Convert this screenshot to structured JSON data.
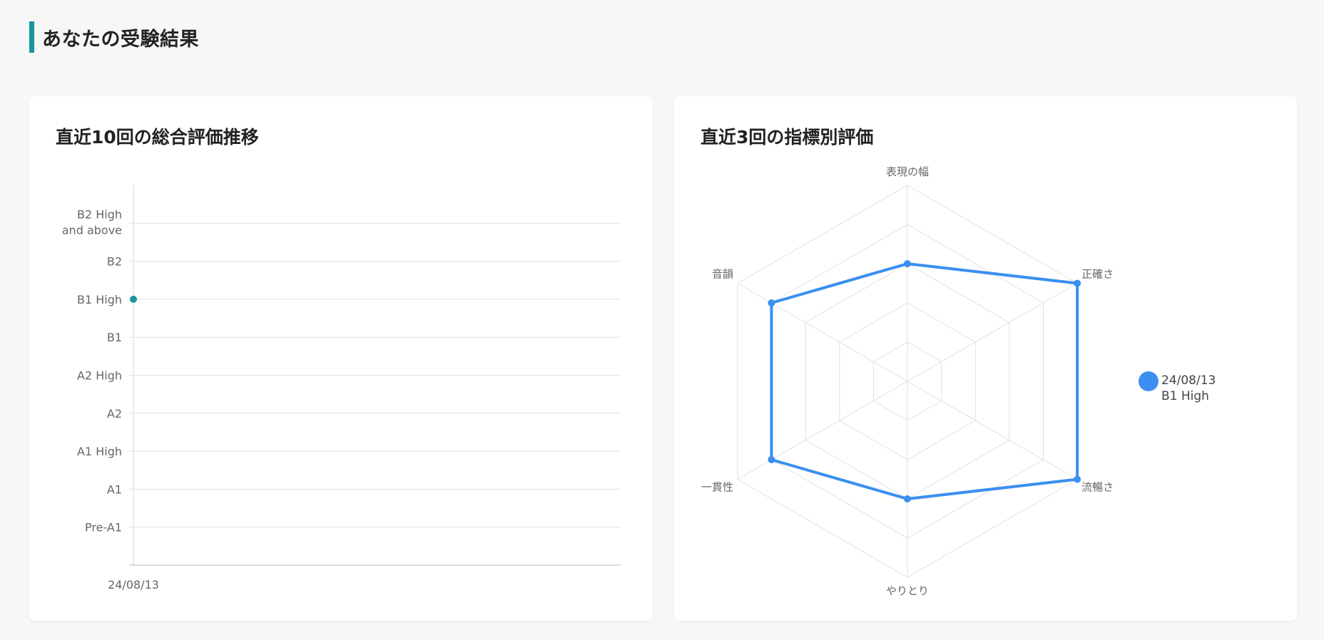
{
  "page": {
    "title": "あなたの受験結果"
  },
  "colors": {
    "accent": "#17949c",
    "series": "#3b8ff0",
    "grid": "#e0e0e0",
    "label": "#666666"
  },
  "cards": {
    "trend": {
      "title": "直近10回の総合評価推移"
    },
    "radar": {
      "title": "直近3回の指標別評価"
    }
  },
  "chart_data": [
    {
      "type": "scatter",
      "title": "直近10回の総合評価推移",
      "x": [
        "24/08/13"
      ],
      "y_levels": [
        {
          "value": 0,
          "label": "Pre-A1"
        },
        {
          "value": 1,
          "label": "A1"
        },
        {
          "value": 2,
          "label": "A1 High"
        },
        {
          "value": 3,
          "label": "A2"
        },
        {
          "value": 4,
          "label": "A2 High"
        },
        {
          "value": 5,
          "label": "B1"
        },
        {
          "value": 6,
          "label": "B1 High"
        },
        {
          "value": 7,
          "label": "B2"
        },
        {
          "value": 8,
          "label": "B2 High and above"
        }
      ],
      "series": [
        {
          "values": [
            6
          ]
        }
      ],
      "ylim": [
        -1,
        9
      ],
      "grid": true,
      "legend": "none"
    },
    {
      "type": "radar",
      "title": "直近3回の指標別評価",
      "axes": [
        "表現の幅",
        "正確さ",
        "流暢さ",
        "やりとり",
        "一貫性",
        "音韻"
      ],
      "max": 5,
      "series": [
        {
          "name": "24/08/13",
          "level": "B1 High",
          "values": [
            3.0,
            5.0,
            5.0,
            3.0,
            4.0,
            4.0
          ]
        }
      ],
      "legend": "right"
    }
  ]
}
